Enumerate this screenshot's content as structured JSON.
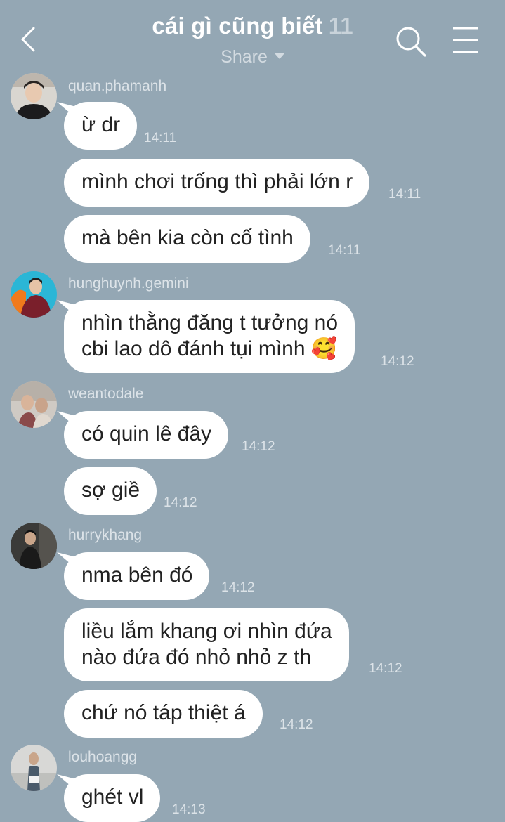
{
  "header": {
    "title": "cái gì cũng biết",
    "member_count": "11",
    "share_label": "Share"
  },
  "messages": [
    {
      "sender": "quan.phamanh",
      "text": [
        "ừ dr"
      ],
      "time": "14:11"
    },
    {
      "sender": "",
      "text": [
        "mình chơi trống thì phải lớn r"
      ],
      "time": "14:11"
    },
    {
      "sender": "",
      "text": [
        "mà bên kia còn cố tình"
      ],
      "time": "14:11"
    },
    {
      "sender": "hunghuynh.gemini",
      "text": [
        "nhìn thằng đăng t tưởng nó",
        "cbi lao dô đánh tụi mình 🥰"
      ],
      "time": "14:12"
    },
    {
      "sender": "weantodale",
      "text": [
        "có quin lê đây"
      ],
      "time": "14:12"
    },
    {
      "sender": "",
      "text": [
        "sợ giề"
      ],
      "time": "14:12"
    },
    {
      "sender": "hurrykhang",
      "text": [
        "nma bên đó"
      ],
      "time": "14:12"
    },
    {
      "sender": "",
      "text": [
        "liều lắm khang ơi nhìn đứa",
        "nào đứa đó nhỏ nhỏ z th"
      ],
      "time": "14:12"
    },
    {
      "sender": "",
      "text": [
        "chứ nó táp thiệt á"
      ],
      "time": "14:12"
    },
    {
      "sender": "louhoangg",
      "text": [
        "ghét vl"
      ],
      "time": "14:13"
    }
  ],
  "colors": {
    "background": "#94a7b4",
    "bubble": "#ffffff"
  },
  "icons": {
    "back": "chevron-left-icon",
    "search": "search-icon",
    "menu": "hamburger-menu-icon",
    "share_dropdown": "caret-down-icon"
  }
}
